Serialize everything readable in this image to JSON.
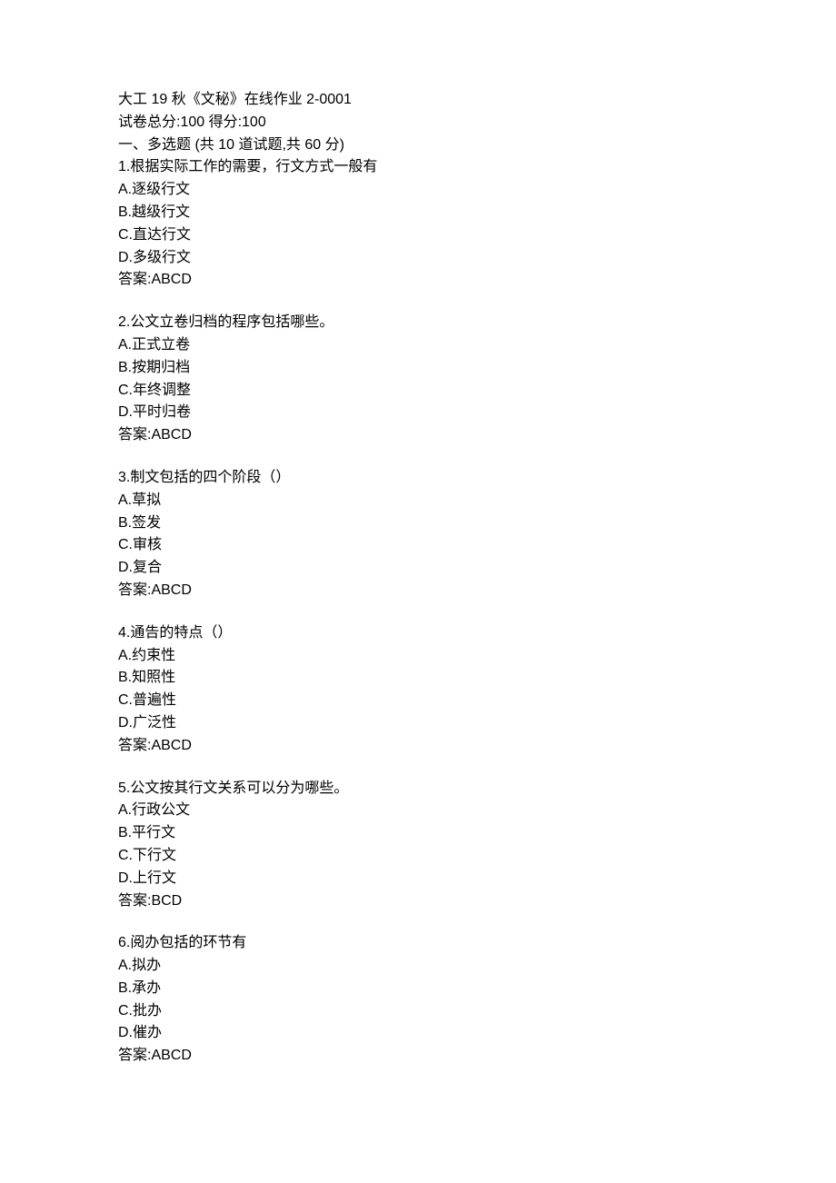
{
  "header": {
    "title": "大工 19 秋《文秘》在线作业 2-0001",
    "score_line": "试卷总分:100    得分:100"
  },
  "section": {
    "heading": "一、多选题 (共 10 道试题,共 60 分)"
  },
  "questions": [
    {
      "text": "1.根据实际工作的需要，行文方式一般有",
      "options": [
        "A.逐级行文",
        "B.越级行文",
        "C.直达行文",
        "D.多级行文"
      ],
      "answer": "答案:ABCD"
    },
    {
      "text": "2.公文立卷归档的程序包括哪些。",
      "options": [
        "A.正式立卷",
        "B.按期归档",
        "C.年终调整",
        "D.平时归卷"
      ],
      "answer": "答案:ABCD"
    },
    {
      "text": "3.制文包括的四个阶段（）",
      "options": [
        "A.草拟",
        "B.签发",
        "C.审核",
        "D.复合"
      ],
      "answer": "答案:ABCD"
    },
    {
      "text": "4.通告的特点（）",
      "options": [
        "A.约束性",
        "B.知照性",
        "C.普遍性",
        "D.广泛性"
      ],
      "answer": "答案:ABCD"
    },
    {
      "text": "5.公文按其行文关系可以分为哪些。",
      "options": [
        "A.行政公文",
        "B.平行文",
        "C.下行文",
        "D.上行文"
      ],
      "answer": "答案:BCD"
    },
    {
      "text": "6.阅办包括的环节有",
      "options": [
        "A.拟办",
        "B.承办",
        "C.批办",
        "D.催办"
      ],
      "answer": "答案:ABCD"
    }
  ]
}
